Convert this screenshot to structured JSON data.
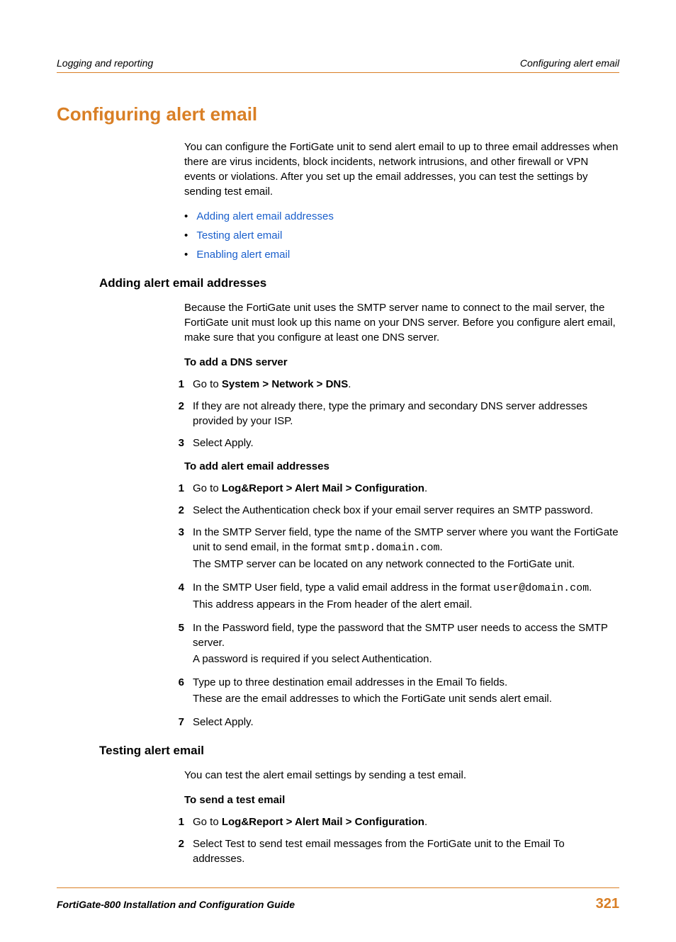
{
  "header": {
    "left": "Logging and reporting",
    "right": "Configuring alert email"
  },
  "title": "Configuring alert email",
  "intro": "You can configure the FortiGate unit to send alert email to up to three email addresses when there are virus incidents, block incidents, network intrusions, and other firewall or VPN events or violations. After you set up the email addresses, you can test the settings by sending test email.",
  "toc": [
    "Adding alert email addresses",
    "Testing alert email",
    "Enabling alert email"
  ],
  "sections": {
    "adding": {
      "heading": "Adding alert email addresses",
      "intro": "Because the FortiGate unit uses the SMTP server name to connect to the mail server, the FortiGate unit must look up this name on your DNS server. Before you configure alert email, make sure that you configure at least one DNS server.",
      "proc1": {
        "title": "To add a DNS server",
        "steps": {
          "s1_pre": "Go to ",
          "s1_bold": "System > Network > DNS",
          "s1_post": ".",
          "s2": "If they are not already there, type the primary and secondary DNS server addresses provided by your ISP.",
          "s3": "Select Apply."
        }
      },
      "proc2": {
        "title": "To add alert email addresses",
        "steps": {
          "s1_pre": "Go to ",
          "s1_bold": "Log&Report > Alert Mail > Configuration",
          "s1_post": ".",
          "s2": "Select the Authentication check box if your email server requires an SMTP password.",
          "s3_a": "In the SMTP Server field, type the name of the SMTP server where you want the FortiGate unit to send email, in the format ",
          "s3_code": "smtp.domain.com",
          "s3_b": ".",
          "s3_c": "The SMTP server can be located on any network connected to the FortiGate unit.",
          "s4_a": "In the SMTP User field, type a valid email address in the format ",
          "s4_code": "user@domain.com",
          "s4_b": ".",
          "s4_c": "This address appears in the From header of the alert email.",
          "s5_a": "In the Password field, type the password that the SMTP user needs to access the SMTP server.",
          "s5_b": "A password is required if you select Authentication.",
          "s6_a": "Type up to three destination email addresses in the Email To fields.",
          "s6_b": "These are the email addresses to which the FortiGate unit sends alert email.",
          "s7": "Select Apply."
        }
      }
    },
    "testing": {
      "heading": "Testing alert email",
      "intro": "You can test the alert email settings by sending a test email.",
      "proc": {
        "title": "To send a test email",
        "steps": {
          "s1_pre": "Go to ",
          "s1_bold": "Log&Report > Alert Mail > Configuration",
          "s1_post": ".",
          "s2": "Select Test to send test email messages from the FortiGate unit to the Email To addresses."
        }
      }
    }
  },
  "footer": {
    "left": "FortiGate-800 Installation and Configuration Guide",
    "page": "321"
  },
  "nums": {
    "n1": "1",
    "n2": "2",
    "n3": "3",
    "n4": "4",
    "n5": "5",
    "n6": "6",
    "n7": "7"
  }
}
